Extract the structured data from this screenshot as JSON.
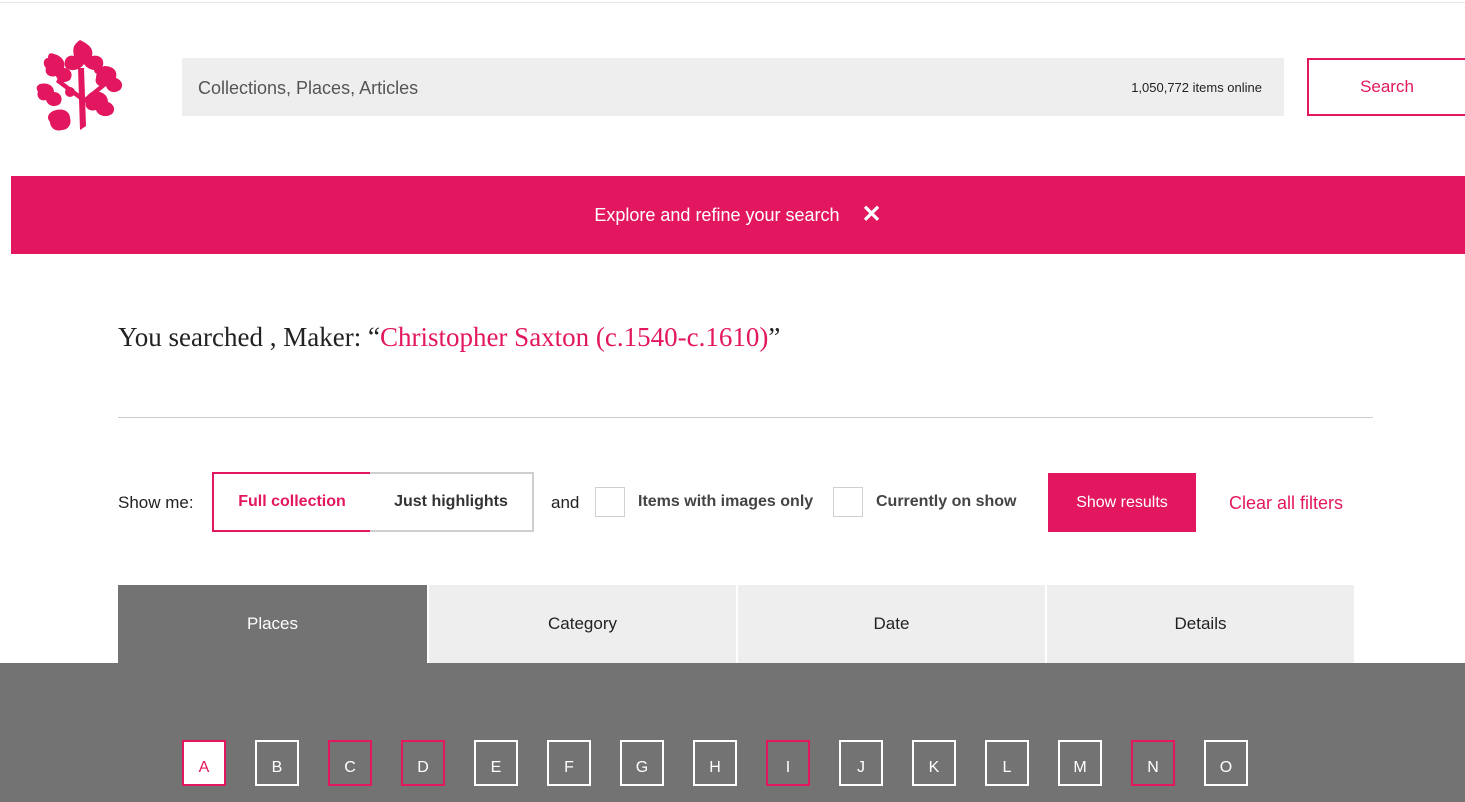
{
  "header": {
    "logo_name": "national-trust-oak-leaf-logo",
    "search_placeholder": "Collections, Places, Articles",
    "items_online": "1,050,772 items online",
    "search_button": "Search"
  },
  "refine_bar": {
    "label": "Explore and refine your search",
    "close_symbol": "✕"
  },
  "search_summary": {
    "prefix": "You searched , Maker: ",
    "open_quote": "“",
    "value": "Christopher Saxton (c.1540-c.1610)",
    "close_quote": "”"
  },
  "filters": {
    "show_me_label": "Show me:",
    "full_collection": "Full collection",
    "just_highlights": "Just highlights",
    "and_label": "and",
    "images_only": "Items with images only",
    "on_show": "Currently on show",
    "show_results": "Show results",
    "clear_all": "Clear all filters"
  },
  "tabs": [
    "Places",
    "Category",
    "Date",
    "Details"
  ],
  "letters": [
    "A",
    "B",
    "C",
    "D",
    "E",
    "F",
    "G",
    "H",
    "I",
    "J",
    "K",
    "L",
    "M",
    "N",
    "O"
  ],
  "colors": {
    "accent": "#e2175f",
    "panel": "#737373",
    "tab_idle": "#eeeeee",
    "search_bg": "#eeeeee"
  }
}
